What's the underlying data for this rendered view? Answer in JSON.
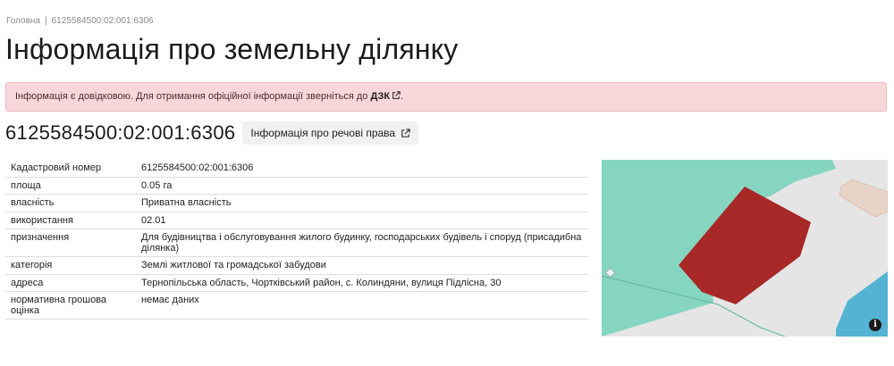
{
  "breadcrumb": {
    "home": "Головна",
    "separator": "|",
    "current": "6125584500:02:001:6306"
  },
  "title": "Інформація про земельну ділянку",
  "alert": {
    "text": "Інформація є довідковою. Для отримання офіційної інформації зверніться до",
    "link": "ДЗК",
    "end": ".",
    "link_icon": "external-link-icon"
  },
  "cadastral_number": "6125584500:02:001:6306",
  "rights_button": {
    "label": "Інформація про речові права",
    "icon": "external-link-icon"
  },
  "rows": [
    {
      "key": "Кадастровий номер",
      "value": "6125584500:02:001:6306"
    },
    {
      "key": "площа",
      "value": "0.05 га"
    },
    {
      "key": "власність",
      "value": "Приватна власність"
    },
    {
      "key": "використання",
      "value": "02.01"
    },
    {
      "key": "призначення",
      "value": "Для будівництва і обслуговування жилого будинку, господарських будівель і споруд (присадибна ділянка)"
    },
    {
      "key": "категорія",
      "value": "Землі житлової та громадської забудови"
    },
    {
      "key": "адреса",
      "value": "Тернопільська область, Чортківський район, с. Колиндяни, вулиця Підлісна, 30"
    },
    {
      "key": "нормативна грошова оцінка",
      "value": "немає даних"
    }
  ],
  "map": {
    "info_icon": "info-icon",
    "colors": {
      "green": "#86d5c1",
      "parcel": "#a82828",
      "gray": "#e5e5e5",
      "blue": "#54b3d2",
      "building": "#e8d3c7"
    }
  }
}
